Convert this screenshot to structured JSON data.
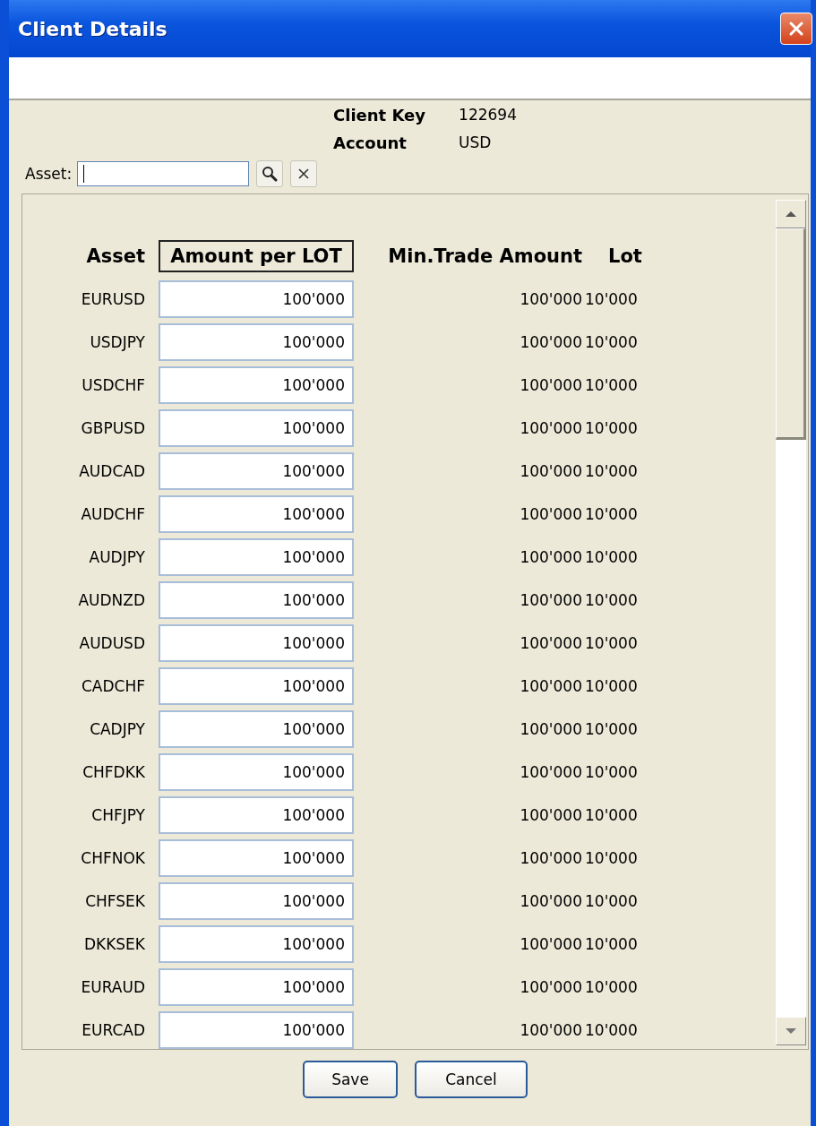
{
  "window": {
    "title": "Client Details"
  },
  "info": [
    {
      "label": "Client Key",
      "value": "122694"
    },
    {
      "label": "Account",
      "value": "USD"
    }
  ],
  "filter": {
    "label": "Asset:",
    "focused": true
  },
  "table": {
    "columns": [
      {
        "label": "Asset",
        "focused": false
      },
      {
        "label": "Amount per LOT",
        "focused": true
      },
      {
        "label": "Min.Trade Amount",
        "focused": false
      },
      {
        "label": "Lot",
        "focused": false
      }
    ],
    "rows": [
      {
        "asset": "EURUSD",
        "amount": "100'000",
        "min_trade": "100'000",
        "lot": "10'000"
      },
      {
        "asset": "USDJPY",
        "amount": "100'000",
        "min_trade": "100'000",
        "lot": "10'000"
      },
      {
        "asset": "USDCHF",
        "amount": "100'000",
        "min_trade": "100'000",
        "lot": "10'000"
      },
      {
        "asset": "GBPUSD",
        "amount": "100'000",
        "min_trade": "100'000",
        "lot": "10'000"
      },
      {
        "asset": "AUDCAD",
        "amount": "100'000",
        "min_trade": "100'000",
        "lot": "10'000"
      },
      {
        "asset": "AUDCHF",
        "amount": "100'000",
        "min_trade": "100'000",
        "lot": "10'000"
      },
      {
        "asset": "AUDJPY",
        "amount": "100'000",
        "min_trade": "100'000",
        "lot": "10'000"
      },
      {
        "asset": "AUDNZD",
        "amount": "100'000",
        "min_trade": "100'000",
        "lot": "10'000"
      },
      {
        "asset": "AUDUSD",
        "amount": "100'000",
        "min_trade": "100'000",
        "lot": "10'000"
      },
      {
        "asset": "CADCHF",
        "amount": "100'000",
        "min_trade": "100'000",
        "lot": "10'000"
      },
      {
        "asset": "CADJPY",
        "amount": "100'000",
        "min_trade": "100'000",
        "lot": "10'000"
      },
      {
        "asset": "CHFDKK",
        "amount": "100'000",
        "min_trade": "100'000",
        "lot": "10'000"
      },
      {
        "asset": "CHFJPY",
        "amount": "100'000",
        "min_trade": "100'000",
        "lot": "10'000"
      },
      {
        "asset": "CHFNOK",
        "amount": "100'000",
        "min_trade": "100'000",
        "lot": "10'000"
      },
      {
        "asset": "CHFSEK",
        "amount": "100'000",
        "min_trade": "100'000",
        "lot": "10'000"
      },
      {
        "asset": "DKKSEK",
        "amount": "100'000",
        "min_trade": "100'000",
        "lot": "10'000"
      },
      {
        "asset": "EURAUD",
        "amount": "100'000",
        "min_trade": "100'000",
        "lot": "10'000"
      },
      {
        "asset": "EURCAD",
        "amount": "100'000",
        "min_trade": "100'000",
        "lot": "10'000"
      }
    ]
  },
  "buttons": [
    "Save",
    "Cancel"
  ]
}
